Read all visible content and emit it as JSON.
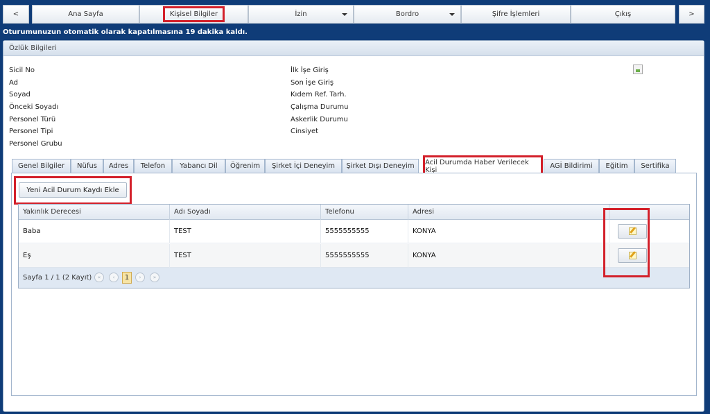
{
  "nav": {
    "prev": "<",
    "next": ">",
    "items": [
      {
        "label": "Ana Sayfa",
        "dropdown": false
      },
      {
        "label": "Kişisel Bilgiler",
        "dropdown": false
      },
      {
        "label": "İzin",
        "dropdown": true
      },
      {
        "label": "Bordro",
        "dropdown": true
      },
      {
        "label": "Şifre İşlemleri",
        "dropdown": false
      },
      {
        "label": "Çıkış",
        "dropdown": false
      }
    ]
  },
  "session_message": "Oturumunuzun otomatik olarak kapatılmasına 19 dakika kaldı.",
  "panel_title": "Özlük Bilgileri",
  "info": {
    "left": [
      "Sicil No",
      "Ad",
      "Soyad",
      "Önceki Soyadı",
      "Personel Türü",
      "Personel Tipi",
      "Personel Grubu"
    ],
    "right": [
      "İlk İşe Giriş",
      "Son İşe Giriş",
      "Kıdem Ref. Tarh.",
      "Çalışma Durumu",
      "Askerlik Durumu",
      "Cinsiyet"
    ]
  },
  "tabs": [
    "Genel Bilgiler",
    "Nüfus",
    "Adres",
    "Telefon",
    "Yabancı Dil",
    "Öğrenim",
    "Şirket İçi Deneyim",
    "Şirket Dışı Deneyim",
    "Acil Durumda Haber Verilecek Kişi",
    "AGİ Bildirimi",
    "Eğitim",
    "Sertifika"
  ],
  "active_tab": "Acil Durumda Haber Verilecek Kişi",
  "add_button": "Yeni Acil Durum Kaydı Ekle",
  "grid": {
    "columns": [
      "Yakınlık Derecesi",
      "Adı Soyadı",
      "Telefonu",
      "Adresi"
    ],
    "rows": [
      [
        "Baba",
        "TEST",
        "5555555555",
        "KONYA"
      ],
      [
        "Eş",
        "TEST",
        "5555555555",
        "KONYA"
      ]
    ],
    "pager_text": "Sayfa 1 / 1 (2 Kayıt)",
    "current_page": "1"
  },
  "colors": {
    "highlight": "#d3202a",
    "background": "#0f3c78"
  }
}
